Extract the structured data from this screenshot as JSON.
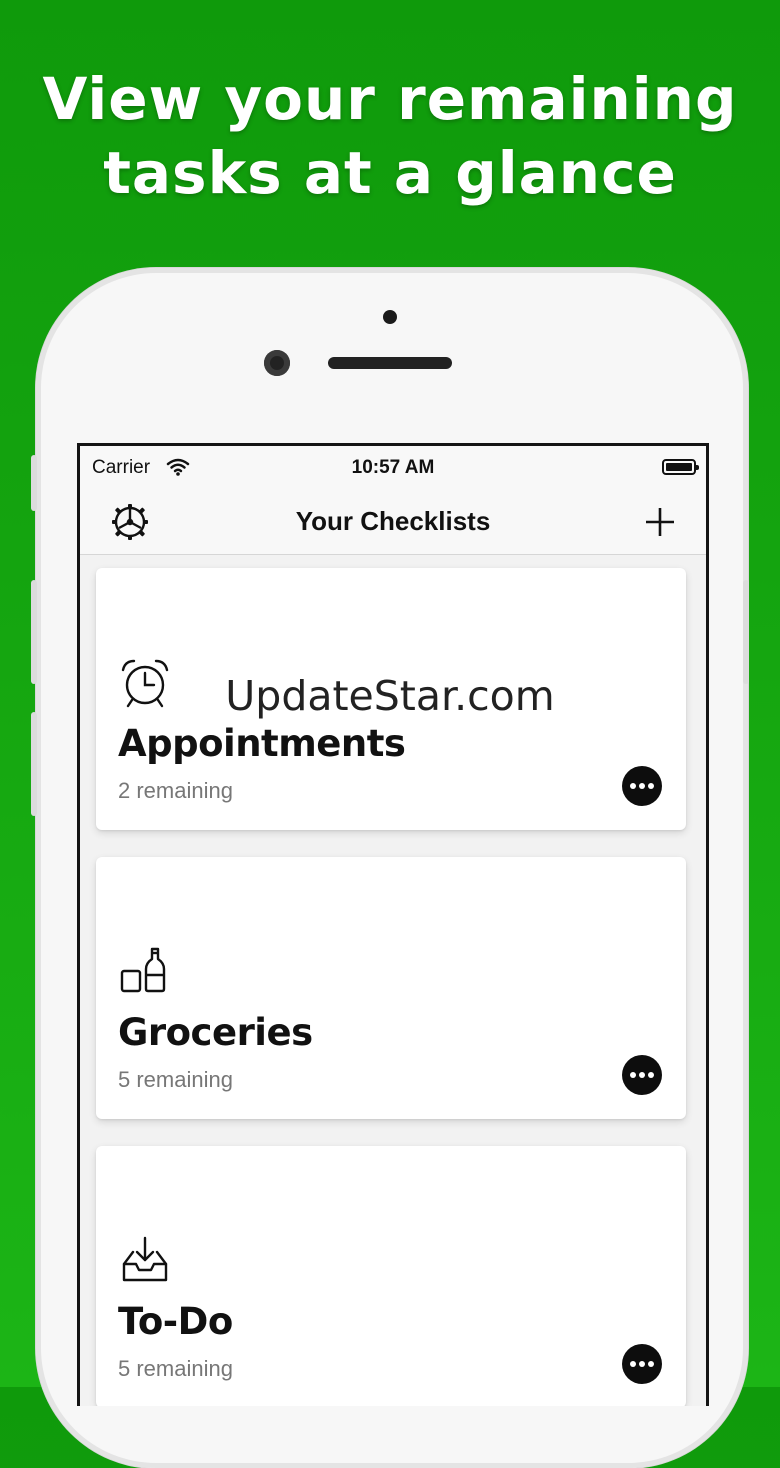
{
  "headline": {
    "line1": "View your remaining",
    "line2": "tasks at a glance"
  },
  "status_bar": {
    "carrier": "Carrier",
    "time": "10:57 AM"
  },
  "nav": {
    "title": "Your Checklists",
    "left_icon": "settings-gear-icon",
    "right_icon": "plus-icon"
  },
  "checklists": [
    {
      "icon": "alarm-clock-icon",
      "title": "Appointments",
      "subtitle": "2 remaining"
    },
    {
      "icon": "groceries-icon",
      "title": "Groceries",
      "subtitle": "5 remaining"
    },
    {
      "icon": "inbox-download-icon",
      "title": "To-Do",
      "subtitle": "5 remaining"
    }
  ],
  "watermark": "UpdateStar.com",
  "colors": {
    "background": "#14a40f",
    "text_dark": "#111111",
    "subtitle": "#777777"
  }
}
